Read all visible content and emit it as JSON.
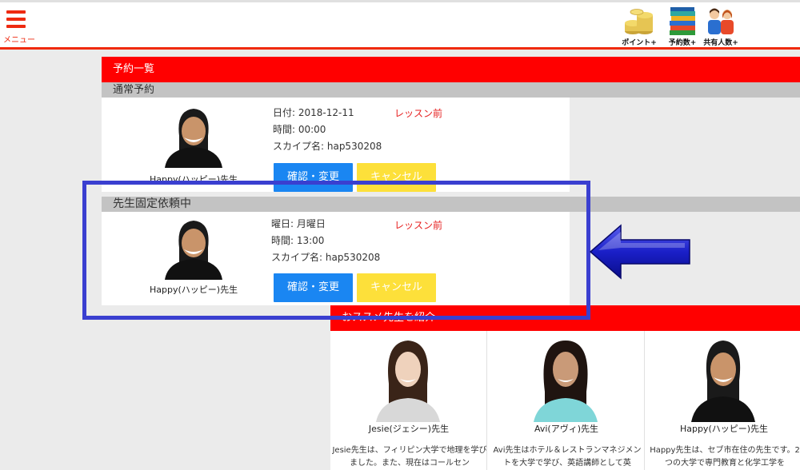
{
  "header": {
    "menu_label": "メニュー",
    "icons": [
      {
        "name": "coins-icon",
        "label": "ポイント+"
      },
      {
        "name": "books-icon",
        "label": "予約数+"
      },
      {
        "name": "people-icon",
        "label": "共有人数+"
      }
    ]
  },
  "reservations": {
    "title": "予約一覧",
    "normal": {
      "heading": "通常予約",
      "teacher": "Happy(ハッピー)先生",
      "lines": [
        "日付: 2018-12-11",
        "時間: 00:00",
        "スカイプ名: hap530208"
      ],
      "status": "レッスン前",
      "confirm_label": "確認・変更",
      "cancel_label": "キャンセル"
    },
    "fixed": {
      "heading": "先生固定依頼中",
      "teacher": "Happy(ハッピー)先生",
      "lines": [
        "曜日: 月曜日",
        "時間: 13:00",
        "スカイプ名: hap530208"
      ],
      "status": "レッスン前",
      "confirm_label": "確認・変更",
      "cancel_label": "キャンセル"
    }
  },
  "recommended": {
    "title": "おススメ先生を紹介",
    "teachers": [
      {
        "name": "Jesie(ジェシー)先生",
        "desc": "Jesie先生は、フィリピン大学で地理を学びました。また、現在はコールセン"
      },
      {
        "name": "Avi(アヴィ)先生",
        "desc": "Avi先生はホテル＆レストランマネジメントを大学で学び、英語講師として英"
      },
      {
        "name": "Happy(ハッピー)先生",
        "desc": "Happy先生は、セブ市在住の先生です。2つの大学で専門教育と化学工学を"
      }
    ]
  },
  "colors": {
    "accent_red": "#ff0000",
    "button_blue": "#1a86f2",
    "button_yellow": "#fde03a",
    "highlight_blue": "#3a3fd0"
  }
}
